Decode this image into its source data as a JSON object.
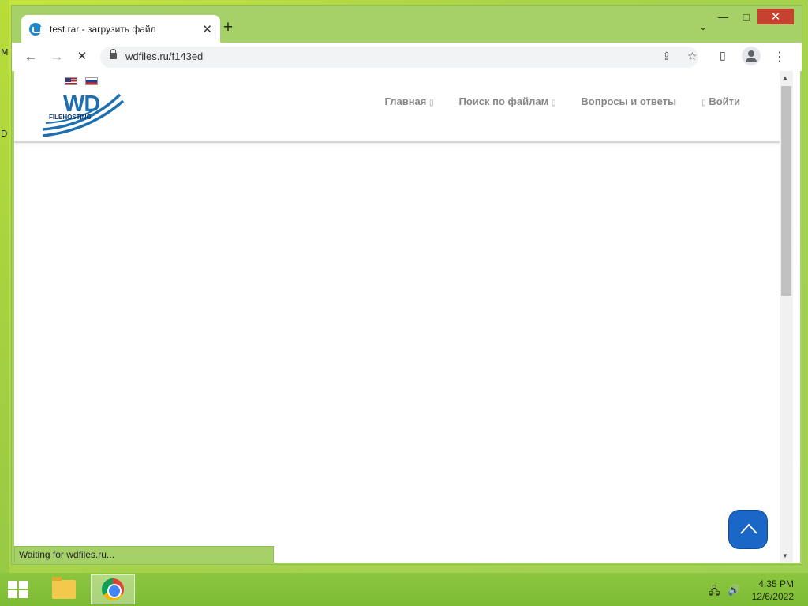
{
  "desktop": {
    "edge_glyphs": [
      "M",
      "D"
    ]
  },
  "window": {
    "controls": {
      "minimize": "—",
      "maximize": "□",
      "close": "✕"
    }
  },
  "tab": {
    "title": "test.rar - загрузить файл",
    "close": "✕",
    "new_tab": "+",
    "search_tabs": "⌄"
  },
  "toolbar": {
    "back": "←",
    "forward": "→",
    "stop": "✕",
    "url": "wdfiles.ru/f143ed",
    "share": "⇪",
    "bookmark": "☆",
    "side_panel": "▯",
    "menu": "⋮"
  },
  "site": {
    "logo_text": "WD",
    "logo_subtext": "FILEHOSTING",
    "nav": [
      {
        "label": "Главная",
        "glyph": "▯"
      },
      {
        "label": "Поиск по файлам",
        "glyph": "▯"
      },
      {
        "label": "Вопросы и ответы",
        "glyph": ""
      },
      {
        "label": "Войти",
        "glyph": "▯"
      }
    ]
  },
  "status_bar": {
    "text": "Waiting for wdfiles.ru..."
  },
  "taskbar": {
    "time": "4:35 PM",
    "date": "12/6/2022"
  },
  "colors": {
    "accent": "#1a67c7",
    "desktop": "#a6d169",
    "close": "#c7412f"
  }
}
